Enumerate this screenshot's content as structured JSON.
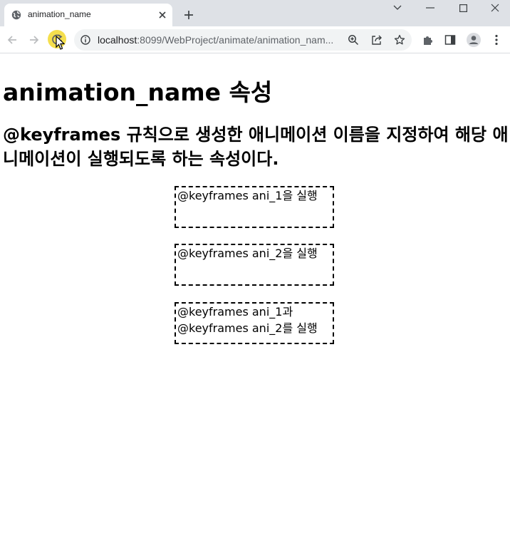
{
  "browser": {
    "tab": {
      "title": "animation_name"
    },
    "address": {
      "host": "localhost",
      "rest": ":8099/WebProject/animate/animation_nam..."
    }
  },
  "page": {
    "heading": "animation_name 속성",
    "description": "@keyframes 규칙으로 생성한 애니메이션 이름을 지정하여 해당 애니메이션이 실행되도록 하는 속성이다.",
    "boxes": [
      {
        "lines": [
          "@keyframes ani_1을 실행"
        ]
      },
      {
        "lines": [
          "@keyframes ani_2을 실행"
        ]
      },
      {
        "lines": [
          "@keyframes ani_1과",
          "@keyframes ani_2를 실행"
        ]
      }
    ]
  }
}
